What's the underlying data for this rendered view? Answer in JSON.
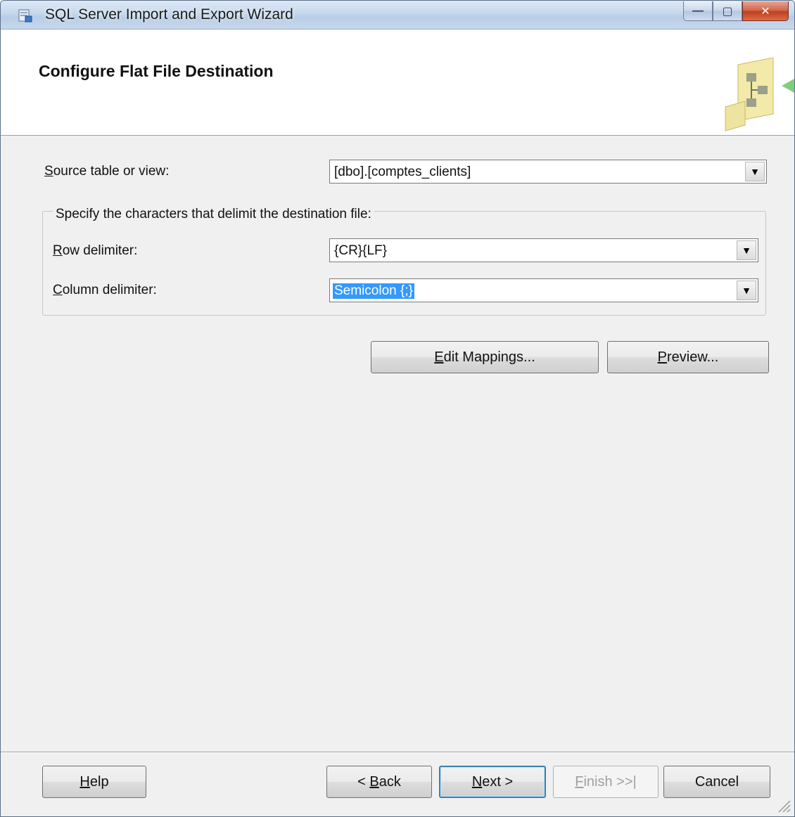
{
  "window": {
    "title": "SQL Server Import and Export Wizard",
    "caption_minimize": "—",
    "caption_maximize": "▢",
    "caption_close": "✕"
  },
  "header": {
    "title": "Configure Flat File Destination"
  },
  "form": {
    "source_label_accel": "S",
    "source_label_rest": "ource table or view:",
    "source_value": "[dbo].[comptes_clients]",
    "group_label": "Specify the characters that delimit the destination file:",
    "row_label_accel": "R",
    "row_label_rest": "ow delimiter:",
    "row_value": "{CR}{LF}",
    "column_label_accel": "C",
    "column_label_rest": "olumn delimiter:",
    "column_value": "Semicolon {;}",
    "dropdown_arrow": "▼"
  },
  "actions": {
    "edit_mappings_accel": "E",
    "edit_mappings_rest": "dit Mappings...",
    "preview_accel": "P",
    "preview_rest": "review..."
  },
  "footer": {
    "help_accel": "H",
    "help_rest": "elp",
    "back_prefix": "< ",
    "back_accel": "B",
    "back_rest": "ack",
    "next_accel": "N",
    "next_rest": "ext >",
    "finish_accel": "F",
    "finish_rest": "inish >>|",
    "cancel": "Cancel"
  }
}
